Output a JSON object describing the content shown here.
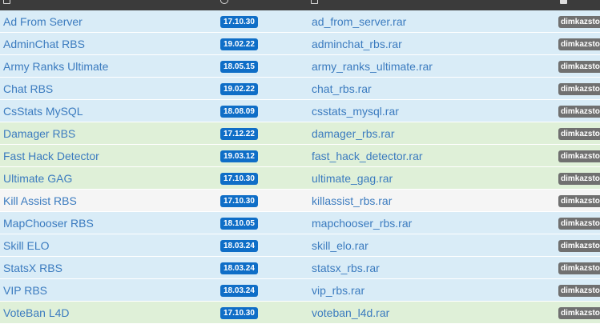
{
  "table": {
    "header_icons": [
      "file-icon",
      "calendar-icon",
      "archive-icon",
      "user-icon"
    ],
    "rows": [
      {
        "name": "Ad From Server",
        "date": "17.10.30",
        "file": "ad_from_server.rar",
        "author": "dimkazsto",
        "tint": "blue"
      },
      {
        "name": "AdminChat RBS",
        "date": "19.02.22",
        "file": "adminchat_rbs.rar",
        "author": "dimkazsto",
        "tint": "blue"
      },
      {
        "name": "Army Ranks Ultimate",
        "date": "18.05.15",
        "file": "army_ranks_ultimate.rar",
        "author": "dimkazsto",
        "tint": "blue"
      },
      {
        "name": "Chat RBS",
        "date": "19.02.22",
        "file": "chat_rbs.rar",
        "author": "dimkazsto",
        "tint": "blue"
      },
      {
        "name": "CsStats MySQL",
        "date": "18.08.09",
        "file": "csstats_mysql.rar",
        "author": "dimkazsto",
        "tint": "blue"
      },
      {
        "name": "Damager RBS",
        "date": "17.12.22",
        "file": "damager_rbs.rar",
        "author": "dimkazsto",
        "tint": "green"
      },
      {
        "name": "Fast Hack Detector",
        "date": "19.03.12",
        "file": "fast_hack_detector.rar",
        "author": "dimkazsto",
        "tint": "green"
      },
      {
        "name": "Ultimate GAG",
        "date": "17.10.30",
        "file": "ultimate_gag.rar",
        "author": "dimkazsto",
        "tint": "green"
      },
      {
        "name": "Kill Assist RBS",
        "date": "17.10.30",
        "file": "killassist_rbs.rar",
        "author": "dimkazsto",
        "tint": "grey"
      },
      {
        "name": "MapChooser RBS",
        "date": "18.10.05",
        "file": "mapchooser_rbs.rar",
        "author": "dimkazsto",
        "tint": "blue"
      },
      {
        "name": "Skill ELO",
        "date": "18.03.24",
        "file": "skill_elo.rar",
        "author": "dimkazsto",
        "tint": "blue"
      },
      {
        "name": "StatsX RBS",
        "date": "18.03.24",
        "file": "statsx_rbs.rar",
        "author": "dimkazsto",
        "tint": "blue"
      },
      {
        "name": "VIP RBS",
        "date": "18.03.24",
        "file": "vip_rbs.rar",
        "author": "dimkazsto",
        "tint": "blue"
      },
      {
        "name": "VoteBan L4D",
        "date": "17.10.30",
        "file": "voteban_l4d.rar",
        "author": "dimkazsto",
        "tint": "green"
      }
    ]
  },
  "colors": {
    "header_bg": "#3b3b3b",
    "link": "#3b7bbf",
    "date_badge": "#0f6ec7",
    "author_badge": "#707070",
    "row_blue": "#d9ecf7",
    "row_green": "#dff0d8",
    "row_grey": "#f5f5f5"
  }
}
